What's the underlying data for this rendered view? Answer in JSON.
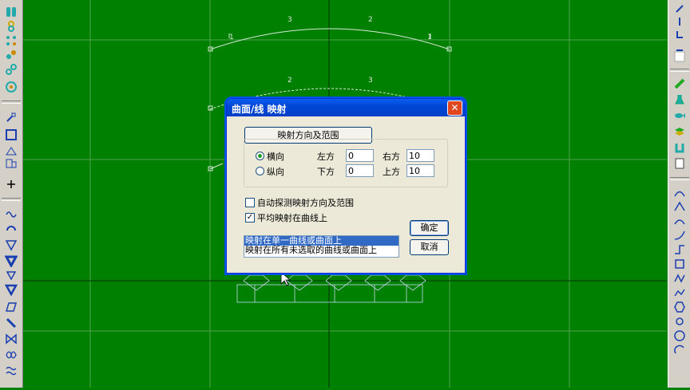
{
  "dialog": {
    "title": "曲面/线 映射",
    "close": "✕",
    "range_button": "映射方向及范围",
    "radio_horizontal": "横向",
    "radio_vertical": "纵向",
    "left_label": "左方",
    "left_value": "0",
    "right_label": "右方",
    "right_value": "10",
    "bottom_label": "下方",
    "bottom_value": "0",
    "top_label": "上方",
    "top_value": "10",
    "auto_detect_label": "自动探测映射方向及范围",
    "auto_detect_checked": false,
    "average_label": "平均映射在曲线上",
    "average_checked": true,
    "ok_label": "确定",
    "cancel_label": "取消",
    "list_items": [
      "映射在单一曲线或曲面上",
      "映射在所有未选取的曲线或曲面上"
    ],
    "list_selected": 0
  },
  "canvas": {
    "background": "#008000",
    "grid_color": "#4fa34f",
    "curve_labels": [
      "3",
      "2",
      "2",
      "3",
      "1",
      "1"
    ]
  },
  "left_toolbar_icons": [
    "color-swatch-icon",
    "spiral-icon",
    "dotted-grid-icon",
    "node-icon",
    "chain-icon",
    "gem-cluster-icon",
    "point-select-icon",
    "rectangle-icon",
    "triangle-flat-icon",
    "stretch-icon",
    "add-point-icon",
    "wave-icon",
    "rotate-icon",
    "triangle-down-icon",
    "triangle-bold-icon",
    "triangle-small-icon",
    "triangle-thick-icon",
    "parallelogram-icon",
    "slash-icon",
    "bowtie-icon",
    "infinity-icon",
    "spring-icon"
  ],
  "right_toolbar_icons": [
    "brush-icon",
    "pencil-icon",
    "corner-icon",
    "line-icon",
    "frame-icon",
    "gem-icon",
    "flask-icon",
    "fish-icon",
    "layers-icon",
    "rings-icon",
    "panel-icon",
    "curve-nodes-icon",
    "curve-peak-icon",
    "curve-s-icon",
    "curve-up-icon",
    "curve-step-icon",
    "box-nodes-icon",
    "zigzag-icon",
    "polyline-icon",
    "hexagon-icon",
    "circle-small-icon",
    "circle-icon",
    "arc-icon"
  ]
}
